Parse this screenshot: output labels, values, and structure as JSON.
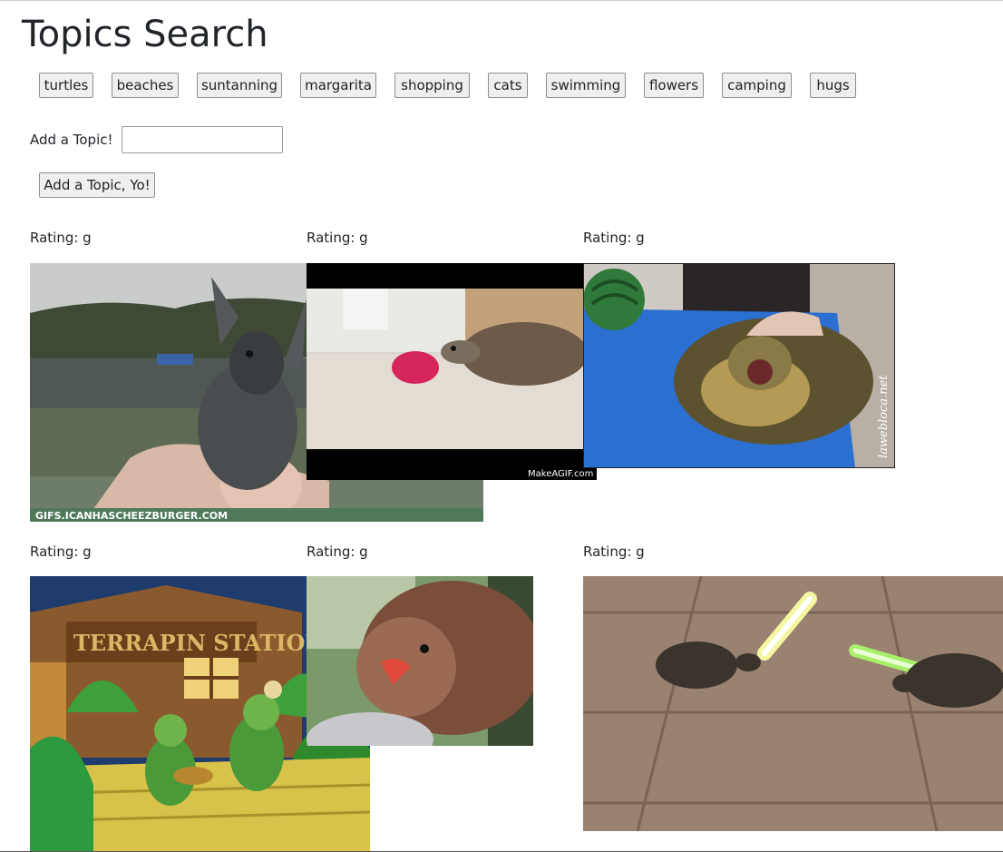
{
  "page": {
    "title": "Topics Search"
  },
  "topics": [
    "turtles",
    "beaches",
    "suntanning",
    "margarita",
    "shopping",
    "cats",
    "swimming",
    "flowers",
    "camping",
    "hugs"
  ],
  "form": {
    "label": "Add a Topic!",
    "input_value": "",
    "input_placeholder": "",
    "button_label": "Add a Topic, Yo!"
  },
  "gifs": [
    {
      "rating": "Rating: g",
      "caption": "GIFS.ICANHASCHEEZBURGER.COM"
    },
    {
      "rating": "Rating: g",
      "caption": "MakeAGIF.com"
    },
    {
      "rating": "Rating: g",
      "caption": "lawebloca.net"
    },
    {
      "rating": "Rating: g",
      "caption": "TERRAPIN STATION"
    },
    {
      "rating": "Rating: g",
      "caption": ""
    },
    {
      "rating": "Rating: g",
      "caption": ""
    }
  ]
}
